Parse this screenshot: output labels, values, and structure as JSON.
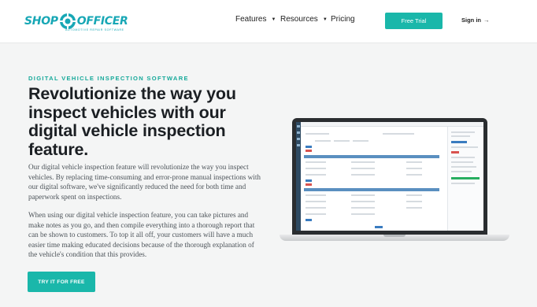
{
  "brand": {
    "name_left": "SHOP",
    "name_right": "OFFICER",
    "tagline": "AUTOMOTIVE REPAIR SOFTWARE",
    "color": "#17a7b5"
  },
  "nav": {
    "features": "Features",
    "resources": "Resources",
    "pricing": "Pricing",
    "caret": "▼",
    "trial_label": "Free Trial",
    "signin_label": "Sign in",
    "signin_arrow": "→"
  },
  "hero": {
    "eyebrow": "DIGITAL VEHICLE INSPECTION SOFTWARE",
    "headline": "Revolutionize the way you inspect vehicles with our digital vehicle inspection feature.",
    "paragraph1": "Our digital vehicle inspection feature will revolutionize the way you inspect vehicles. By replacing time-consuming and error-prone manual inspections with our digital software, we've significantly reduced the need for both time and paperwork spent on inspections.",
    "paragraph2": "When using our digital vehicle inspection feature, you can take pictures and make notes as you go, and then compile everything into a thorough report that can be shown to customers. To top it all off, your customers will have a much easier time making educated decisions because of the thorough explanation of the vehicle's condition that this provides.",
    "cta_label": "TRY IT FOR FREE"
  },
  "colors": {
    "accent": "#1ab7aa",
    "background": "#f4f5f5"
  }
}
